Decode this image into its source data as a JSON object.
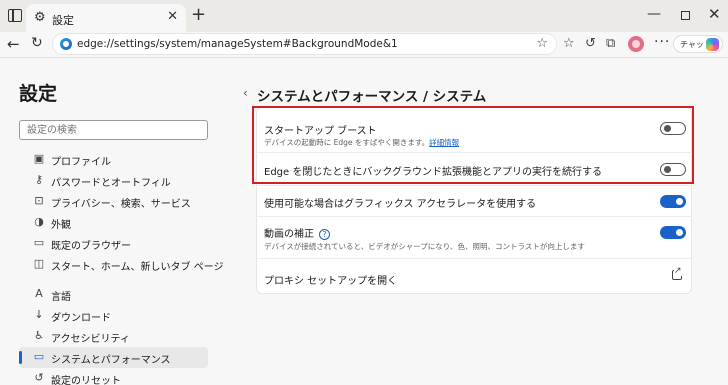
{
  "tab": {
    "title": "設定"
  },
  "address": {
    "url": "edge://settings/system/manageSystem#BackgroundMode&1"
  },
  "toolbar": {
    "chat_label": "チャット"
  },
  "sidebar": {
    "title": "設定",
    "search_placeholder": "設定の検索",
    "items": [
      {
        "label": "プロファイル",
        "icon": "profile-icon"
      },
      {
        "label": "パスワードとオートフィル",
        "icon": "key-icon"
      },
      {
        "label": "プライバシー、検索、サービス",
        "icon": "lock-icon"
      },
      {
        "label": "外観",
        "icon": "appearance-icon"
      },
      {
        "label": "既定のブラウザー",
        "icon": "browser-icon"
      },
      {
        "label": "スタート、ホーム、新しいタブ ページ",
        "icon": "home-tab-icon"
      },
      {
        "label": "言語",
        "icon": "language-icon"
      },
      {
        "label": "ダウンロード",
        "icon": "download-icon"
      },
      {
        "label": "アクセシビリティ",
        "icon": "accessibility-icon"
      },
      {
        "label": "システムとパフォーマンス",
        "icon": "system-icon",
        "active": true
      },
      {
        "label": "設定のリセット",
        "icon": "reset-icon"
      }
    ]
  },
  "main": {
    "title": "システムとパフォーマンス / システム",
    "rows": [
      {
        "title": "スタートアップ ブースト",
        "desc": "デバイスの起動時に Edge をすばやく開きます。",
        "link": "詳細情報",
        "toggle": "off"
      },
      {
        "title": "Edge を閉じたときにバックグラウンド拡張機能とアプリの実行を続行する",
        "toggle": "off"
      },
      {
        "title": "使用可能な場合はグラフィックス アクセラレータを使用する",
        "toggle": "on"
      },
      {
        "title": "動画の補正",
        "desc": "デバイスが接続されていると、ビデオがシャープになり、色、照明、コントラストが向上します",
        "toggle": "on"
      },
      {
        "title": "プロキシ セットアップを開く"
      }
    ]
  },
  "colors": {
    "accent": "#1a62c7",
    "highlight": "#d42025"
  }
}
